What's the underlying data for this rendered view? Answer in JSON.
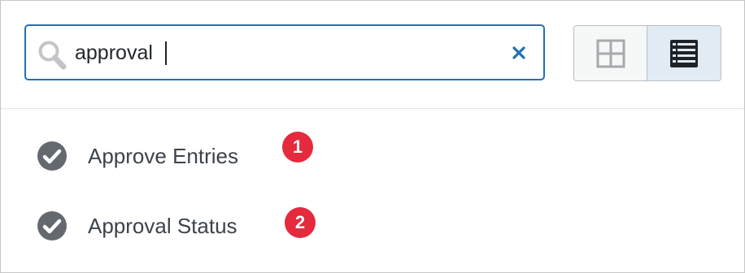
{
  "search": {
    "value": "approval",
    "placeholder": "",
    "icon": "search-icon",
    "clear_icon": "close-icon"
  },
  "view_toggle": {
    "options": [
      {
        "icon": "grid-view-icon",
        "selected": false
      },
      {
        "icon": "list-view-icon",
        "selected": true
      }
    ]
  },
  "results": [
    {
      "label": "Approve Entries",
      "icon": "checkmark-circle-icon",
      "badge": "1"
    },
    {
      "label": "Approval Status",
      "icon": "checkmark-circle-icon",
      "badge": "2"
    }
  ],
  "colors": {
    "accent": "#2271b1",
    "badge": "#e42a3c",
    "check": "#646970",
    "text": "#3c434a"
  }
}
